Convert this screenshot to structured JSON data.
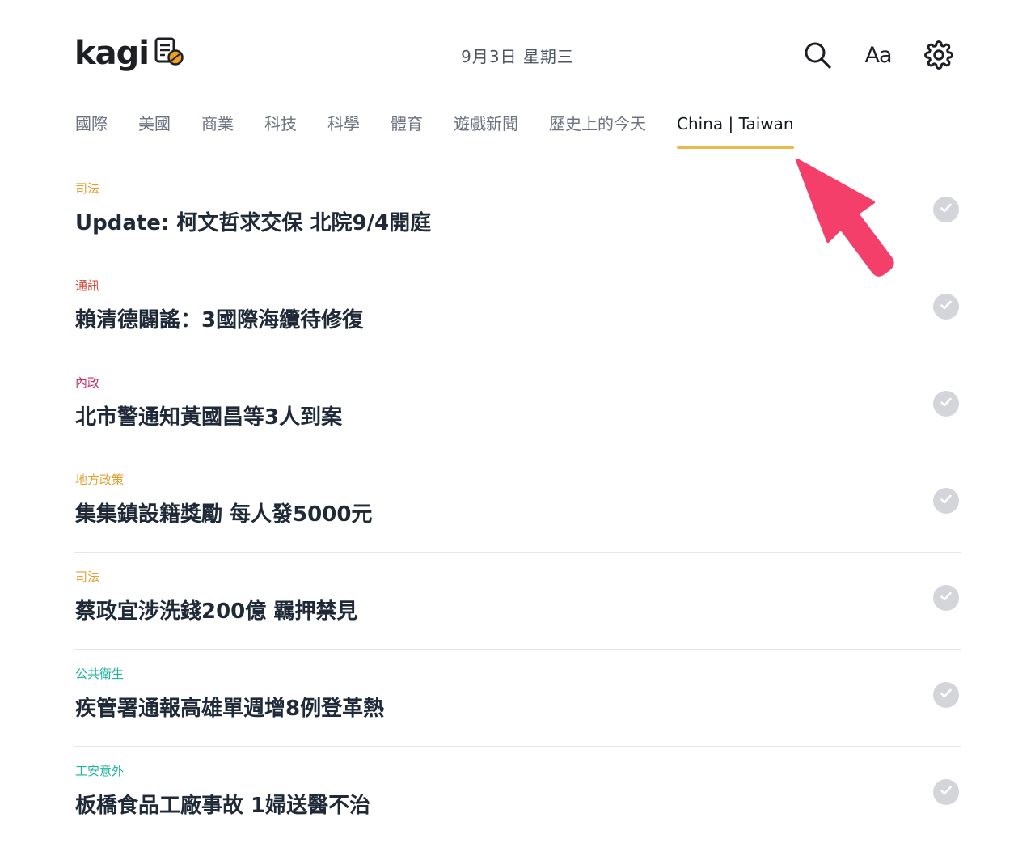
{
  "header": {
    "logo_text": "kagi",
    "date": "9月3日 星期三",
    "font_button_label": "Aa"
  },
  "icons": {
    "logo": "news-logo-icon",
    "search": "search-icon",
    "font": "font-size-icon",
    "settings": "gear-icon",
    "read": "check-icon"
  },
  "tabs": [
    {
      "label": "國際",
      "active": false
    },
    {
      "label": "美國",
      "active": false
    },
    {
      "label": "商業",
      "active": false
    },
    {
      "label": "科技",
      "active": false
    },
    {
      "label": "科學",
      "active": false
    },
    {
      "label": "體育",
      "active": false
    },
    {
      "label": "遊戲新聞",
      "active": false
    },
    {
      "label": "歷史上的今天",
      "active": false
    },
    {
      "label": "China | Taiwan",
      "active": true
    }
  ],
  "stories": [
    {
      "category": "司法",
      "category_color": "#e0a030",
      "title": "Update: 柯文哲求交保 北院9/4開庭"
    },
    {
      "category": "通訊",
      "category_color": "#d9483b",
      "title": "賴清德闢謠：3國際海纜待修復"
    },
    {
      "category": "內政",
      "category_color": "#c62a6b",
      "title": "北市警通知黃國昌等3人到案"
    },
    {
      "category": "地方政策",
      "category_color": "#e0a030",
      "title": "集集鎮設籍獎勵 每人發5000元"
    },
    {
      "category": "司法",
      "category_color": "#e0a030",
      "title": "蔡政宜涉洗錢200億 羈押禁見"
    },
    {
      "category": "公共衛生",
      "category_color": "#1fb39a",
      "title": "疾管署通報高雄單週增8例登革熱"
    },
    {
      "category": "工安意外",
      "category_color": "#1fb39a",
      "title": "板橋食品工廠事故 1婦送醫不治"
    }
  ],
  "colors": {
    "accent_underline": "#f0b84a",
    "arrow": "#f43f6a",
    "check_bg": "#d4d5da"
  }
}
